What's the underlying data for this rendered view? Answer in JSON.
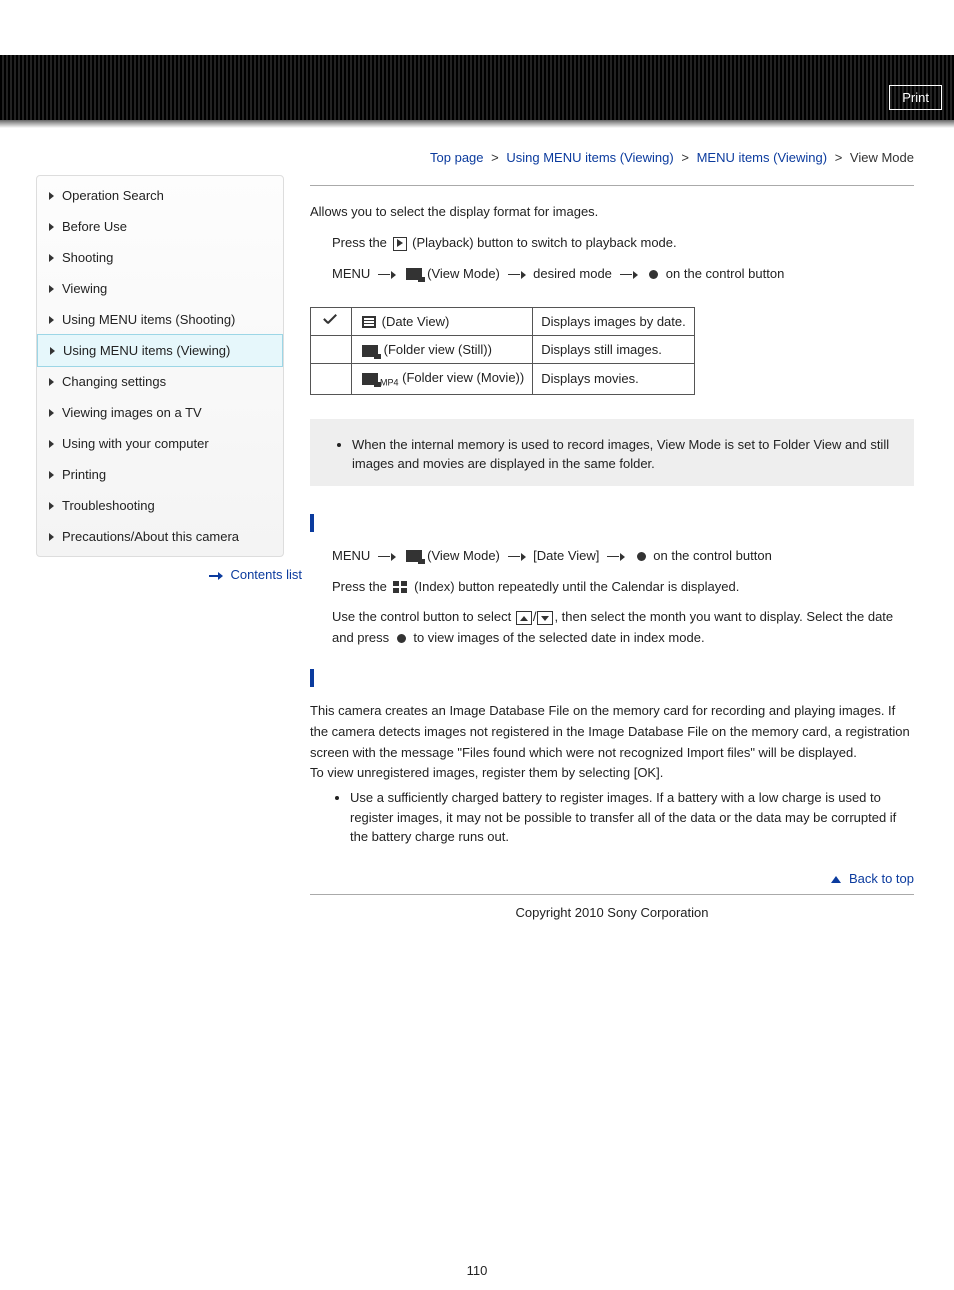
{
  "header": {
    "print": "Print"
  },
  "breadcrumb": {
    "top": "Top page",
    "l1": "Using MENU items (Viewing)",
    "l2": "MENU items (Viewing)",
    "current": "View Mode",
    "sep": ">"
  },
  "sidebar": {
    "items": [
      {
        "label": "Operation Search",
        "active": false
      },
      {
        "label": "Before Use",
        "active": false
      },
      {
        "label": "Shooting",
        "active": false
      },
      {
        "label": "Viewing",
        "active": false
      },
      {
        "label": "Using MENU items (Shooting)",
        "active": false
      },
      {
        "label": "Using MENU items (Viewing)",
        "active": true
      },
      {
        "label": "Changing settings",
        "active": false
      },
      {
        "label": "Viewing images on a TV",
        "active": false
      },
      {
        "label": "Using with your computer",
        "active": false
      },
      {
        "label": "Printing",
        "active": false
      },
      {
        "label": "Troubleshooting",
        "active": false
      },
      {
        "label": "Precautions/About this camera",
        "active": false
      }
    ],
    "contents_list": "Contents list"
  },
  "main": {
    "intro": "Allows you to select the display format for images.",
    "step1_a": "Press the ",
    "step1_b": "(Playback) button to switch to playback mode.",
    "step2_menu": "MENU",
    "step2_viewmode": "(View Mode)",
    "step2_desired": "desired mode",
    "step2_rest": "on the control button",
    "table": {
      "rows": [
        {
          "label": "(Date View)",
          "desc": "Displays images by date."
        },
        {
          "label": "(Folder view (Still))",
          "desc": "Displays still images."
        },
        {
          "label": "(Folder view (Movie))",
          "desc": "Displays movies.",
          "sub": "MP4"
        }
      ]
    },
    "note1": "When the internal memory is used to record images, View Mode is set to Folder View and still images and movies are displayed in the same folder.",
    "cal_heading": "",
    "cal_step1_menu": "MENU",
    "cal_step1_viewmode": "(View Mode)",
    "cal_step1_dateview": "[Date View]",
    "cal_step1_rest": "on the control button",
    "cal_step2_a": "Press the ",
    "cal_step2_b": "(Index) button repeatedly until the Calendar is displayed.",
    "cal_step3_a": "Use the control button to select ",
    "cal_step3_b": ", then select the month you want to display. Select the date and press ",
    "cal_step3_c": " to view images of the selected date in index mode.",
    "db_heading": "",
    "db_p1": "This camera creates an Image Database File on the memory card for recording and playing images. If the camera detects images not registered in the Image Database File on the memory card, a registration screen with the message \"Files found which were not recognized Import files\" will be displayed.",
    "db_p2": "To view unregistered images, register them by selecting [OK].",
    "db_bullet": "Use a sufficiently charged battery to register images. If a battery with a low charge is used to register images, it may not be possible to transfer all of the data or the data may be corrupted if the battery charge runs out.",
    "back_to_top": "Back to top",
    "copyright": "Copyright 2010 Sony Corporation",
    "page_num": "110"
  }
}
